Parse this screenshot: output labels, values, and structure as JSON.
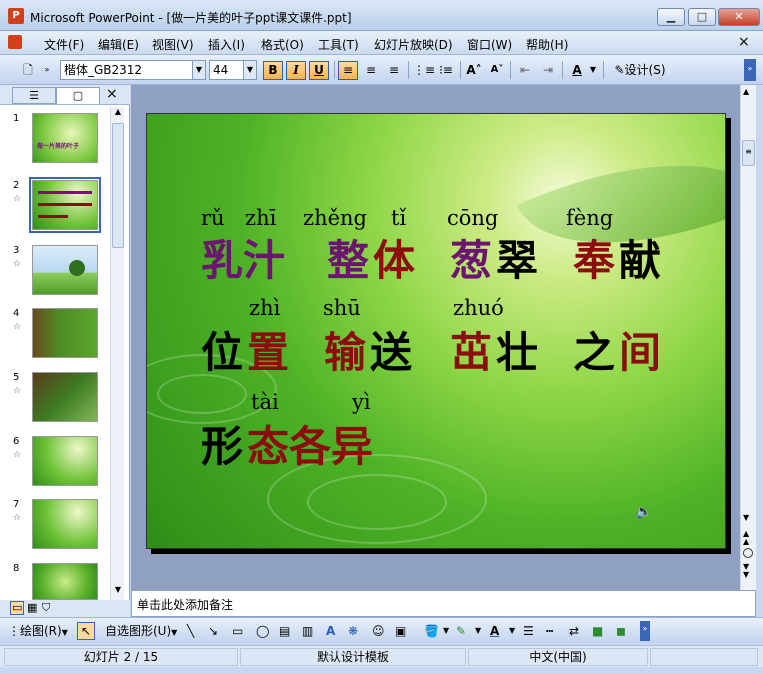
{
  "window": {
    "app_icon_label": "P",
    "title": "Microsoft PowerPoint - [做一片美的叶子ppt课文课件.ppt]",
    "min_label": "▁",
    "max_label": "□",
    "close_label": "✕"
  },
  "menu": {
    "items": [
      "文件(F)",
      "编辑(E)",
      "视图(V)",
      "插入(I)",
      "格式(O)",
      "工具(T)",
      "幻灯片放映(D)",
      "窗口(W)",
      "帮助(H)"
    ],
    "doc_close": "×"
  },
  "toolbar": {
    "font_name": "楷体_GB2312",
    "font_size": "44",
    "bold": "B",
    "italic": "I",
    "underline": "U",
    "design_label": "设计(S)"
  },
  "left_pane": {
    "slides": [
      {
        "num": "1",
        "title": "做一片美的叶子"
      },
      {
        "num": "2",
        "title": ""
      },
      {
        "num": "3",
        "title": ""
      },
      {
        "num": "4",
        "title": ""
      },
      {
        "num": "5",
        "title": ""
      },
      {
        "num": "6",
        "title": ""
      },
      {
        "num": "7",
        "title": ""
      },
      {
        "num": "8",
        "title": ""
      }
    ],
    "pane_close": "×"
  },
  "slide": {
    "pinyin": {
      "ru": "rǔ",
      "zhi1": "zhī",
      "zheng": "zhěng",
      "ti": "tǐ",
      "cong": "cōng",
      "feng": "fèng",
      "zhi4": "zhì",
      "shu": "shū",
      "zhuo": "zhuó",
      "tai": "tài",
      "yi": "yì"
    },
    "line1": {
      "a1": "乳汁",
      "b1": "整",
      "b2": "体",
      "c1": "葱",
      "c2": "翠",
      "d1": "奉",
      "d2": "献"
    },
    "line2": {
      "a1": "位",
      "a2": "置",
      "b1": "输",
      "b2": "送",
      "c1": "茁",
      "c2": "壮",
      "d1": "之",
      "d2": "间"
    },
    "line3": {
      "a1": "形",
      "a2": "态各异"
    },
    "colors": {
      "purple": "#6b1470",
      "darkred": "#8b0d0d",
      "black": "#000000"
    }
  },
  "notes": {
    "placeholder": "单击此处添加备注"
  },
  "drawbar": {
    "draw_label": "绘图(R)",
    "autoshape_label": "自选图形(U)"
  },
  "status": {
    "slide_info": "幻灯片 2 / 15",
    "template": "默认设计模板",
    "language": "中文(中国)"
  }
}
